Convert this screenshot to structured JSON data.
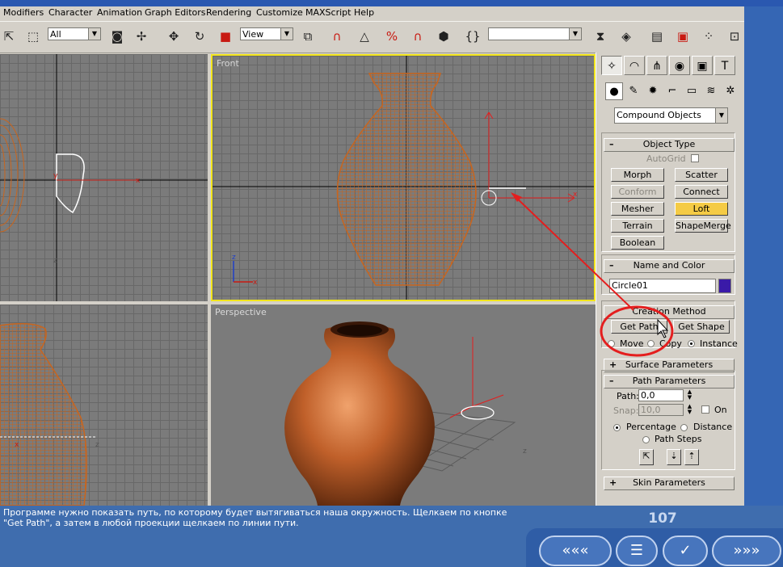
{
  "menu": [
    "Modifiers",
    "Character",
    "Animation",
    "Graph Editors",
    "Rendering",
    "Customize",
    "MAXScript",
    "Help"
  ],
  "toolbar": {
    "selection_filter": "All",
    "reference_coord": "View",
    "named_selection": ""
  },
  "viewports": {
    "front_label": "Front",
    "perspective_label": "Perspective"
  },
  "panel": {
    "category": "Compound Objects",
    "object_type": {
      "title": "Object Type",
      "autogrid": "AutoGrid",
      "buttons": [
        {
          "label": "Morph",
          "state": "normal"
        },
        {
          "label": "Scatter",
          "state": "normal"
        },
        {
          "label": "Conform",
          "state": "disabled"
        },
        {
          "label": "Connect",
          "state": "normal"
        },
        {
          "label": "Mesher",
          "state": "normal"
        },
        {
          "label": "Loft",
          "state": "active"
        },
        {
          "label": "Terrain",
          "state": "normal"
        },
        {
          "label": "ShapeMerge",
          "state": "normal"
        },
        {
          "label": "Boolean",
          "state": "normal"
        }
      ]
    },
    "name_color": {
      "title": "Name and Color",
      "name": "Circle01",
      "color": "#3a1aa8"
    },
    "creation_method": {
      "title": "Creation Method",
      "get_path": "Get Path",
      "get_shape": "Get Shape",
      "move": "Move",
      "copy": "Copy",
      "instance": "Instance"
    },
    "surface_parameters": {
      "title": "Surface Parameters"
    },
    "path_parameters": {
      "title": "Path Parameters",
      "path_label": "Path:",
      "path_value": "0,0",
      "snap_label": "Snap:",
      "snap_value": "10,0",
      "on_label": "On",
      "percentage": "Percentage",
      "distance": "Distance",
      "path_steps": "Path Steps"
    },
    "skin_parameters": {
      "title": "Skin Parameters"
    }
  },
  "caption": {
    "line1": "Программе нужно показать путь, по которому будет вытягиваться наша окружность. Щелкаем по кнопке",
    "line2": "\"Get Path\", а затем в любой проекции щелкаем по линии пути."
  },
  "page_number": "107",
  "nav": {
    "prev": "«««",
    "contents": "☰",
    "check": "✓",
    "next": "»»»"
  },
  "colors": {
    "accent": "#f5cb45",
    "annotation": "#e41e1e",
    "wireframe": "#c8651e",
    "viewport_active": "#f2e51c"
  }
}
